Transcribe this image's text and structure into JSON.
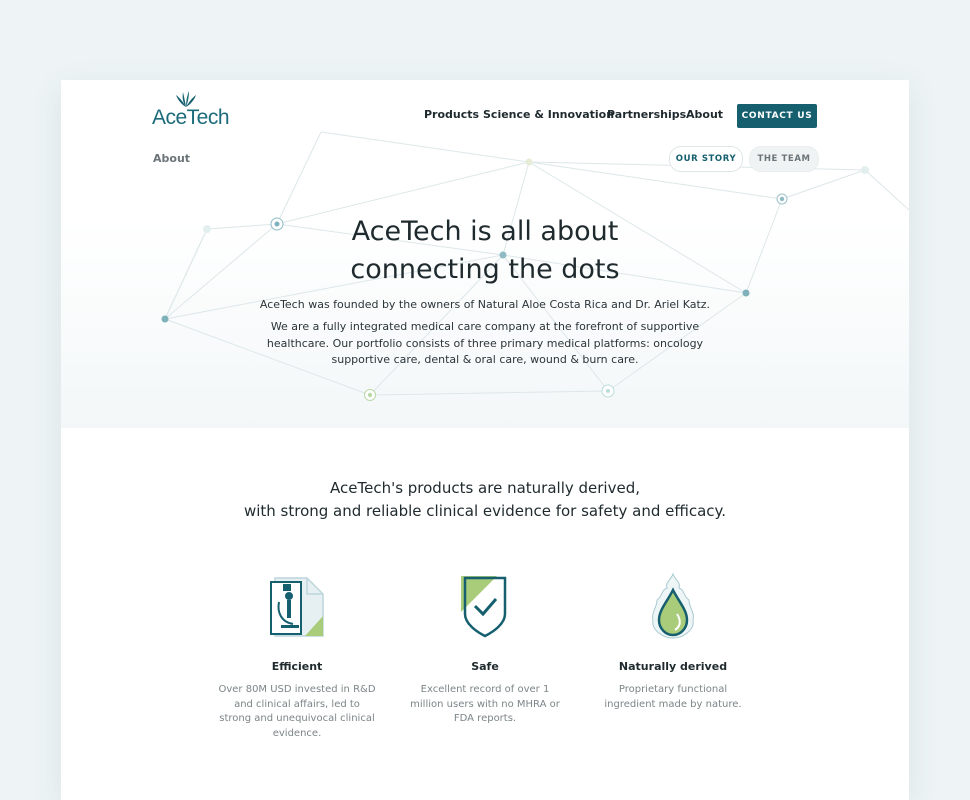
{
  "brand": {
    "logo_text": "AceTech",
    "accent": "#155f6f",
    "leaf": "#8dbf5a"
  },
  "nav": {
    "items": [
      "Products",
      "Science & Innovation",
      "Partnerships",
      "About"
    ],
    "contact": "CONTACT US"
  },
  "breadcrumb": "About",
  "subnav": {
    "story": "OUR STORY",
    "team": "THE TEAM"
  },
  "hero": {
    "title_line1": "AceTech is all about",
    "title_line2": "connecting the dots",
    "line1": "AceTech was founded by the owners of Natural Aloe Costa Rica and Dr. Ariel Katz.",
    "paragraph": "We are a fully integrated medical care company at the forefront of supportive healthcare. Our portfolio consists of three primary medical platforms: oncology supportive care, dental & oral care, wound & burn care."
  },
  "tagline": {
    "line1": "AceTech's products are naturally derived,",
    "line2": "with strong and reliable clinical evidence for safety and efficacy."
  },
  "features": [
    {
      "icon": "microscope-document-icon",
      "title": "Efficient",
      "desc": "Over 80M USD invested in R&D and clinical affairs, led to strong and unequivocal clinical evidence."
    },
    {
      "icon": "shield-check-icon",
      "title": "Safe",
      "desc": "Excellent record of over 1 million users with no MHRA or FDA reports."
    },
    {
      "icon": "aloe-drop-icon",
      "title": "Naturally derived",
      "desc": "Proprietary functional ingredient made by nature."
    }
  ]
}
